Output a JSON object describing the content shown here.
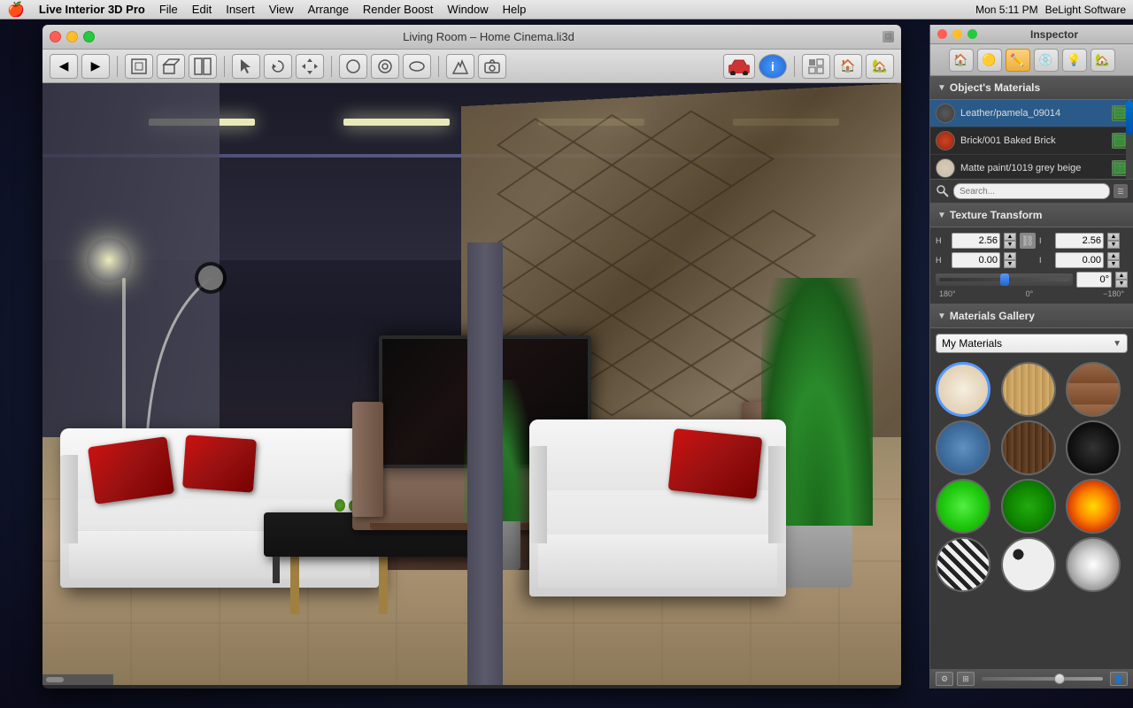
{
  "menubar": {
    "apple": "🍎",
    "app_name": "Live Interior 3D Pro",
    "items": [
      "File",
      "Edit",
      "Insert",
      "View",
      "Arrange",
      "Render Boost",
      "Window",
      "Help"
    ],
    "right": {
      "time": "Mon 5:11 PM",
      "company": "BeLight Software"
    }
  },
  "window": {
    "title": "Living Room – Home Cinema.li3d",
    "close_label": "✕",
    "minimize_label": "–",
    "maximize_label": "+"
  },
  "inspector": {
    "title": "Inspector",
    "tabs": [
      {
        "icon": "🏠",
        "label": "room"
      },
      {
        "icon": "🟠",
        "label": "object"
      },
      {
        "icon": "✏️",
        "label": "material",
        "active": true
      },
      {
        "icon": "💿",
        "label": "texture"
      },
      {
        "icon": "💡",
        "label": "light"
      },
      {
        "icon": "🏡",
        "label": "scene"
      }
    ],
    "materials_section": {
      "header": "Object's Materials",
      "items": [
        {
          "name": "Leather/pamela_09014",
          "color": "#4a4a4a"
        },
        {
          "name": "Brick/001 Baked Brick",
          "color": "#bb3322"
        },
        {
          "name": "Matte paint/1019 grey beige",
          "color": "#d4c8b0"
        }
      ]
    },
    "texture_transform": {
      "header": "Texture Transform",
      "row1_label1": "H",
      "row1_val1": "2.56",
      "row1_val2": "2.56",
      "row2_label1": "H",
      "row2_val1": "0.00",
      "row2_val2": "0.00",
      "angle_neg180": "180°",
      "angle_0": "0°",
      "angle_pos180": "−180°",
      "angle_current": "0°"
    },
    "gallery": {
      "header": "Materials Gallery",
      "dropdown_label": "My Materials",
      "items": [
        {
          "id": "cream",
          "class": "mat-cream",
          "selected": true
        },
        {
          "id": "wood-light",
          "class": "mat-wood-light",
          "selected": false
        },
        {
          "id": "brick",
          "class": "mat-brick",
          "selected": false
        },
        {
          "id": "water",
          "class": "mat-water",
          "selected": false
        },
        {
          "id": "wood-dark",
          "class": "mat-wood-dark",
          "selected": false
        },
        {
          "id": "black",
          "class": "mat-black",
          "selected": false
        },
        {
          "id": "green-bright",
          "class": "mat-green-bright",
          "selected": false
        },
        {
          "id": "green-dark",
          "class": "mat-green-dark",
          "selected": false
        },
        {
          "id": "fire",
          "class": "mat-fire",
          "selected": false
        },
        {
          "id": "zebra",
          "class": "mat-zebra",
          "selected": false
        },
        {
          "id": "spots",
          "class": "mat-spots",
          "selected": false
        },
        {
          "id": "silver",
          "class": "mat-silver",
          "selected": false
        }
      ]
    }
  }
}
